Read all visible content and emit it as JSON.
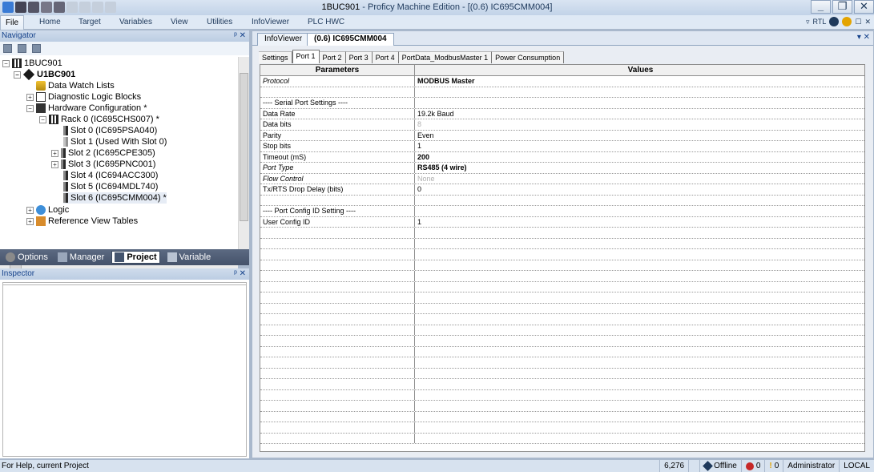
{
  "window": {
    "title": "1BUC901",
    "app_suffix": " - Proficy Machine Edition - [(0.6) IC695CMM004]"
  },
  "menu": {
    "items": [
      "File",
      "Home",
      "Target",
      "Variables",
      "View",
      "Utilities",
      "InfoViewer",
      "PLC HWC"
    ],
    "right_label": "RTL"
  },
  "navigator": {
    "title": "Navigator",
    "pin": "ᵖ ✕",
    "tree": [
      "1BUC901",
      "U1BC901",
      "Data Watch Lists",
      "Diagnostic Logic Blocks",
      "Hardware Configuration *",
      "Rack 0 (IC695CHS007) *",
      "Slot 0 (IC695PSA040)",
      "Slot 1 (Used With Slot 0)",
      "Slot 2 (IC695CPE305)",
      "Slot 3 (IC695PNC001)",
      "Slot 4 (IC694ACC300)",
      "Slot 5 (IC694MDL740)",
      "Slot 6 (IC695CMM004) *",
      "Logic",
      "Reference View Tables"
    ],
    "tabs": [
      "Options",
      "Manager",
      "Project",
      "Variable"
    ]
  },
  "inspector": {
    "title": "Inspector"
  },
  "document": {
    "tabs": [
      "InfoViewer",
      "(0.6) IC695CMM004"
    ],
    "subtabs": [
      "Settings",
      "Port 1",
      "Port 2",
      "Port 3",
      "Port 4",
      "PortData_ModbusMaster 1",
      "Power Consumption"
    ],
    "columns": [
      "Parameters",
      "Values"
    ],
    "rows": [
      {
        "p": "Protocol",
        "v": "MODBUS Master"
      },
      {
        "p": "",
        "v": ""
      },
      {
        "p": "---- Serial Port Settings ----",
        "v": ""
      },
      {
        "p": "Data Rate",
        "v": "19.2k Baud"
      },
      {
        "p": "Data bits",
        "v": "8"
      },
      {
        "p": "Parity",
        "v": "Even"
      },
      {
        "p": "Stop bits",
        "v": "1"
      },
      {
        "p": "Timeout (mS)",
        "v": "200"
      },
      {
        "p": "Port Type",
        "v": "RS485 (4 wire)"
      },
      {
        "p": "Flow Control",
        "v": "None"
      },
      {
        "p": "Tx/RTS Drop Delay (bits)",
        "v": "0"
      },
      {
        "p": "",
        "v": ""
      },
      {
        "p": "---- Port Config ID Setting ----",
        "v": ""
      },
      {
        "p": "User Config ID",
        "v": "1"
      }
    ]
  },
  "status": {
    "help": "For Help, current Project",
    "count": "6,276",
    "mode": "Offline",
    "errors": "0",
    "warnings": "0",
    "user": "Administrator",
    "location": "LOCAL"
  },
  "colors": {
    "accent": "#15428b",
    "background": "#a9b8cc"
  }
}
